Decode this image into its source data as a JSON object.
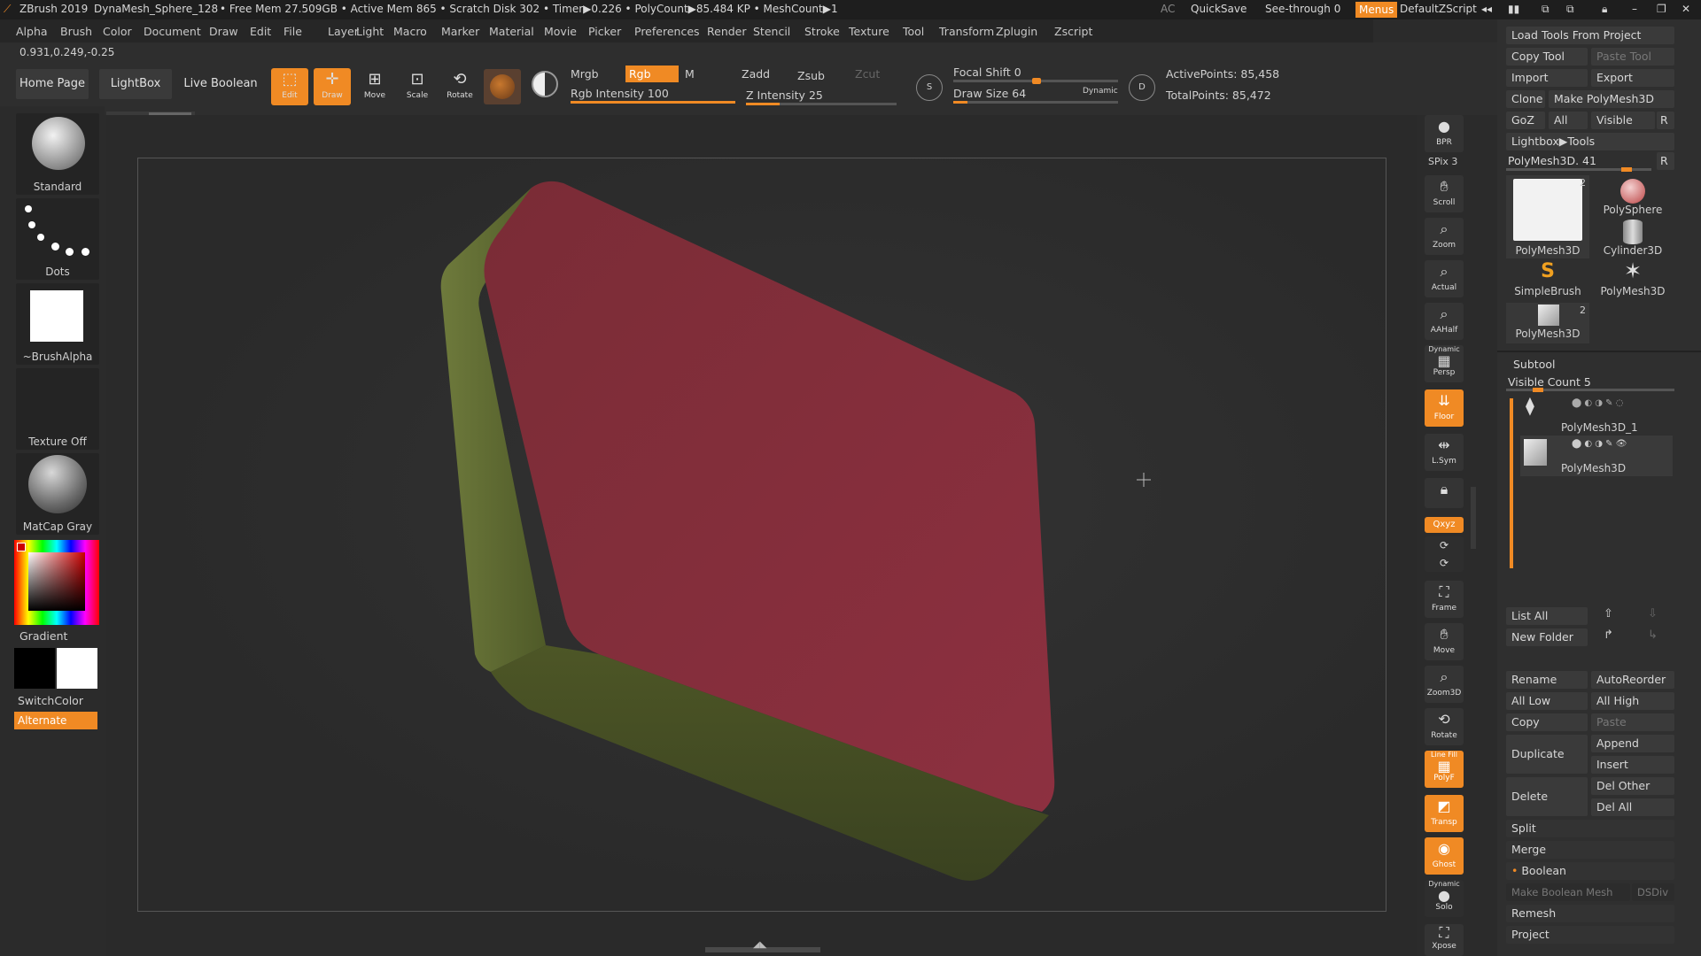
{
  "titlebar": {
    "app": "ZBrush 2019",
    "doc": "DynaMesh_Sphere_128",
    "stats": "• Free Mem 27.509GB • Active Mem 865 • Scratch Disk 302 • Timer▶0.226 • PolyCount▶85.484 KP • MeshCount▶1",
    "ac": "AC",
    "quicksave": "QuickSave",
    "seethrough": "See-through",
    "seethrough_value": "0",
    "menus": "Menus",
    "zscript": "DefaultZScript"
  },
  "menubar": [
    "Alpha",
    "Brush",
    "Color",
    "Document",
    "Draw",
    "Edit",
    "File",
    "Layer",
    "Light",
    "Macro",
    "Marker",
    "Material",
    "Movie",
    "Picker",
    "Preferences",
    "Render",
    "Stencil",
    "Stroke",
    "Texture",
    "Tool",
    "Transform",
    "Zplugin",
    "Zscript"
  ],
  "coords": "0.931,0.249,-0.25",
  "toolbar": {
    "home": "Home Page",
    "lightbox": "LightBox",
    "liveboolean": "Live Boolean",
    "edit": "Edit",
    "draw": "Draw",
    "move": "Move",
    "scale": "Scale",
    "rotate": "Rotate",
    "mrgb": "Mrgb",
    "rgb": "Rgb",
    "m": "M",
    "rgb_intensity_label": "Rgb Intensity",
    "rgb_intensity": 100,
    "zadd": "Zadd",
    "zsub": "Zsub",
    "zcut": "Zcut",
    "z_intensity_label": "Z Intensity",
    "z_intensity": 25,
    "focal_label": "Focal Shift",
    "focal": 0,
    "drawsize_label": "Draw Size",
    "drawsize": 64,
    "dynamic": "Dynamic",
    "active_points": "ActivePoints: 85,458",
    "total_points": "TotalPoints: 85,472"
  },
  "leftpanel": {
    "standard": "Standard",
    "dots": "Dots",
    "brushalpha": "~BrushAlpha",
    "texture": "Texture Off",
    "matcap": "MatCap Gray",
    "gradient": "Gradient",
    "switchcolor": "SwitchColor",
    "alternate": "Alternate"
  },
  "vbar": {
    "bpr": "BPR",
    "spix": "SPix 3",
    "scroll": "Scroll",
    "zoom": "Zoom",
    "actual": "Actual",
    "aahalf": "AAHalf",
    "dynamic": "Dynamic",
    "persp": "Persp",
    "floor": "Floor",
    "lsym": "L.Sym",
    "xyz": "Qxyz",
    "frame": "Frame",
    "move": "Move",
    "zoom3d": "Zoom3D",
    "rotate": "Rotate",
    "linefill": "Line Fill",
    "polyf": "PolyF",
    "transp": "Transp",
    "ghost": "Ghost",
    "dynamic2": "Dynamic",
    "solo": "Solo",
    "xpose": "Xpose"
  },
  "rightpanel": {
    "load_tools": "Load Tools From Project",
    "copy_tool": "Copy Tool",
    "paste_tool": "Paste Tool",
    "import": "Import",
    "export": "Export",
    "clone": "Clone",
    "make_polymesh": "Make PolyMesh3D",
    "goz": "GoZ",
    "all": "All",
    "visible": "Visible",
    "r": "R",
    "lightbox_tools": "Lightbox▶Tools",
    "polymesh_slider": "PolyMesh3D. 41",
    "thumbs": [
      "PolyMesh3D",
      "PolySphere",
      "Cylinder3D",
      "SimpleBrush",
      "PolyMesh3D",
      "PolyMesh3D"
    ],
    "thumb_badge_1": "2",
    "thumb_badge_6": "2",
    "subtool": "Subtool",
    "visible_count": "Visible Count 5",
    "subtool_1": "PolyMesh3D_1",
    "subtool_2": "PolyMesh3D",
    "list_all": "List All",
    "new_folder": "New Folder",
    "rename": "Rename",
    "autoreorder": "AutoReorder",
    "all_low": "All Low",
    "all_high": "All High",
    "copy": "Copy",
    "paste": "Paste",
    "duplicate": "Duplicate",
    "append": "Append",
    "insert": "Insert",
    "delete": "Delete",
    "del_other": "Del Other",
    "del_all": "Del All",
    "split": "Split",
    "merge": "Merge",
    "boolean": "Boolean",
    "make_boolean": "Make Boolean Mesh",
    "dsdiv": "DSDiv",
    "remesh": "Remesh",
    "project": "Project"
  },
  "colors": {
    "accent": "#f08a24",
    "top_face": "#8a2e3c",
    "side_face": "#5e6a30",
    "front_face": "#4f5a28"
  }
}
